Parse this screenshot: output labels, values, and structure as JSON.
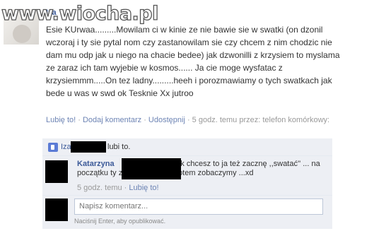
{
  "watermark": "www.wiocha.pl",
  "post": {
    "author": "Iza",
    "text": "Esie KUrwaa.........Mowilam ci w kinie ze nie bawie sie w swatki (on dzonil wczoraj i ty sie pytal nom czy zastanowilam sie czy chcem z nim chodzic nie dam mu odp jak u niego na chacie bedee) jak dzwonilli z krzysiem to myslama ze zaraz ich tam wyjebie w kosmos...... Ja cie moge wysfatac z krzysiemmm.....On tez ladny.........heeh i porozmawiamy o tych swatkach jak bede u was w swd ok Tesknie Xx jutroo",
    "like": "Lubię to!",
    "sep1": " · ",
    "comment": "Dodaj komentarz",
    "sep2": " · ",
    "share": "Udostępnij",
    "time": " · 5 godz. temu przez: telefon komórkowy: "
  },
  "likes": {
    "name": "Iza",
    "suffix": "lubi to."
  },
  "comment": {
    "author": "Katarzyna",
    "text": "...Taa... -,-...Jak chcesz to ja też zacznę ,,swatać'' ... na początku ty z Hubertem... a potem zobaczymy ...xd",
    "time": "5 godz. temu · ",
    "like": "Lubię to!"
  },
  "form": {
    "placeholder": "Napisz komentarz...",
    "hint": "Naciśnij Enter, aby opublikować."
  },
  "colors": {
    "link": "#3b5998",
    "ufi_bg": "#edeff4",
    "meta": "#999999"
  }
}
